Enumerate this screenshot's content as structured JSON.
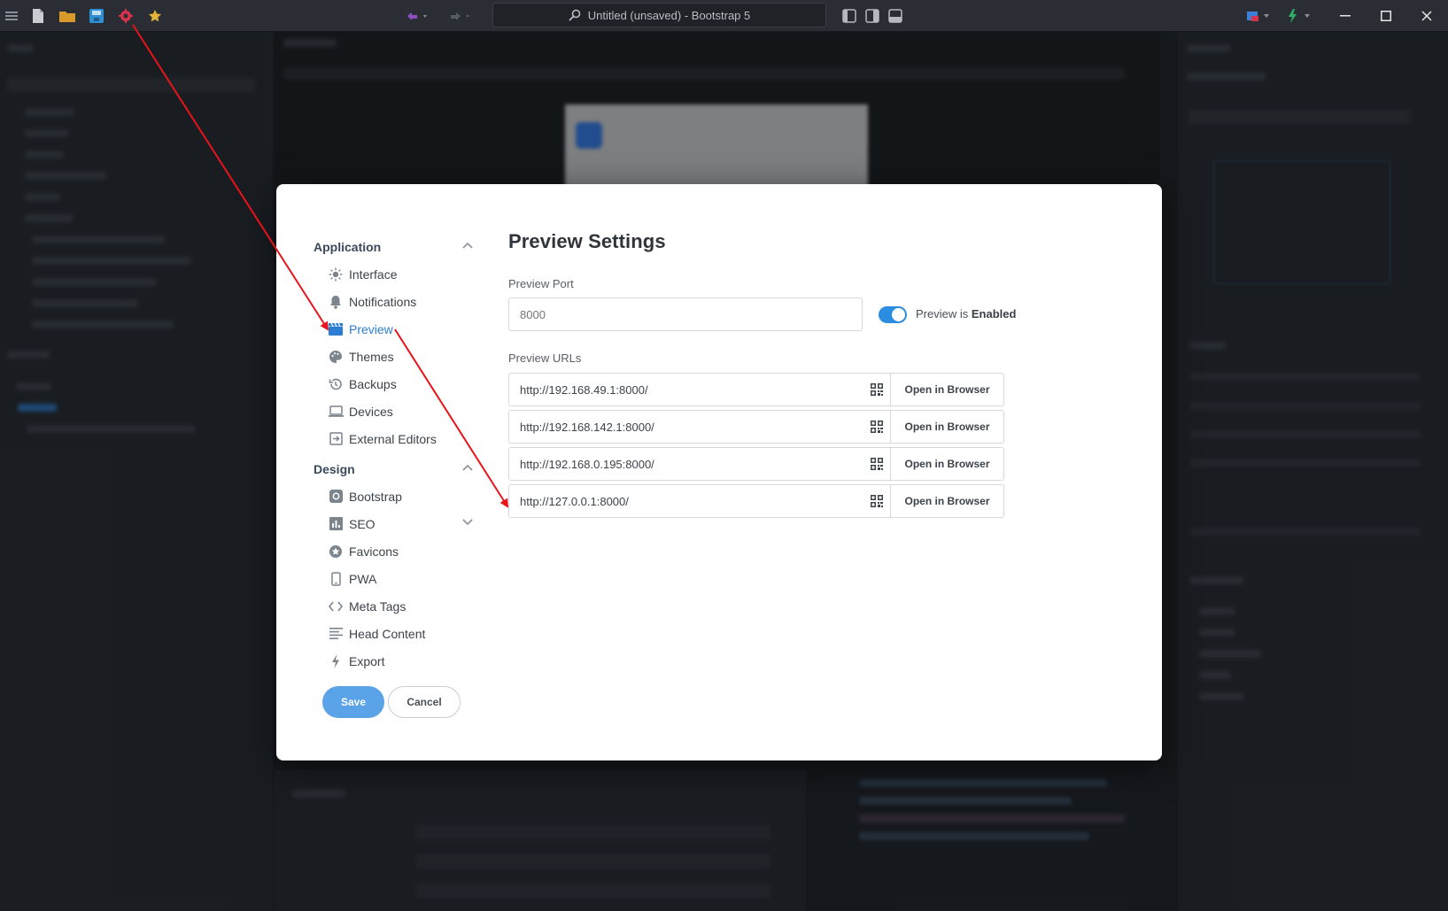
{
  "titlebar": {
    "search_text": "Untitled (unsaved) - Bootstrap 5",
    "icons": [
      "menu-icon",
      "new-file-icon",
      "folder-icon",
      "save-icon",
      "settings-icon",
      "star-icon",
      "undo-icon",
      "redo-icon",
      "search-icon",
      "layout-left-icon",
      "layout-split-icon",
      "layout-bottom-icon",
      "device-icon",
      "flash-icon"
    ]
  },
  "modal": {
    "sidebar": {
      "application": {
        "heading": "Application",
        "items": [
          {
            "label": "Interface",
            "icon": "sun-icon"
          },
          {
            "label": "Notifications",
            "icon": "bell-icon"
          },
          {
            "label": "Preview",
            "icon": "clapper-icon"
          },
          {
            "label": "Themes",
            "icon": "palette-icon"
          },
          {
            "label": "Backups",
            "icon": "history-icon"
          },
          {
            "label": "Devices",
            "icon": "laptop-icon"
          },
          {
            "label": "External Editors",
            "icon": "external-icon"
          }
        ]
      },
      "design": {
        "heading": "Design",
        "items": [
          {
            "label": "Bootstrap",
            "icon": "gear-box-icon"
          },
          {
            "label": "SEO",
            "icon": "chart-icon"
          },
          {
            "label": "Favicons",
            "icon": "badge-icon"
          },
          {
            "label": "PWA",
            "icon": "phone-icon"
          },
          {
            "label": "Meta Tags",
            "icon": "code-icon"
          },
          {
            "label": "Head Content",
            "icon": "lines-icon"
          },
          {
            "label": "Export",
            "icon": "bolt-icon"
          }
        ]
      }
    },
    "title": "Preview Settings",
    "port": {
      "label": "Preview Port",
      "placeholder": "8000",
      "toggle_prefix": "Preview is ",
      "toggle_state": "Enabled"
    },
    "urls": {
      "label": "Preview URLs",
      "button_label": "Open in Browser",
      "items": [
        "http://192.168.49.1:8000/",
        "http://192.168.142.1:8000/",
        "http://192.168.0.195:8000/",
        "http://127.0.0.1:8000/"
      ]
    },
    "save_label": "Save",
    "cancel_label": "Cancel"
  },
  "colors": {
    "accent": "#2a7dd3",
    "save_button": "#5aa3e8",
    "toggle_on": "#2a8ddf",
    "annotation_arrow": "#e8141a"
  }
}
